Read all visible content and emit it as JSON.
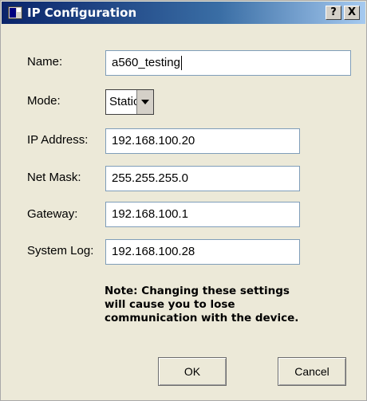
{
  "window": {
    "title": "IP Configuration",
    "help_label": "?",
    "close_label": "X"
  },
  "form": {
    "name": {
      "label": "Name:",
      "value": "a560_testing"
    },
    "mode": {
      "label": "Mode:",
      "value": "Static"
    },
    "ip_address": {
      "label": "IP Address:",
      "value": "192.168.100.20"
    },
    "net_mask": {
      "label": "Net Mask:",
      "value": "255.255.255.0"
    },
    "gateway": {
      "label": "Gateway:",
      "value": "192.168.100.1"
    },
    "system_log": {
      "label": "System Log:",
      "value": "192.168.100.28"
    }
  },
  "note": "Note: Changing these settings will cause you to lose communication with the device.",
  "buttons": {
    "ok": "OK",
    "cancel": "Cancel"
  }
}
